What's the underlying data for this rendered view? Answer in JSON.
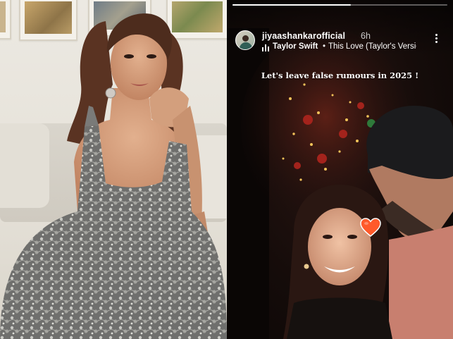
{
  "story": {
    "username": "jiyaashankarofficial",
    "time_ago": "6h",
    "music": {
      "artist": "Taylor Swift",
      "separator": "•",
      "song": "This Love (Taylor's Versio..."
    },
    "caption": "Let's leave false rumours in 2025 !",
    "progress": 0.55,
    "sticker": "orange-heart-emoji"
  },
  "colors": {
    "story_bg": "#150c0a",
    "dress": "#6f6f6d",
    "sequin": "#c9c9c4",
    "beanie": "#1b1b1d",
    "sweater": "#c87f6f",
    "heart": "#ff5a2a"
  }
}
